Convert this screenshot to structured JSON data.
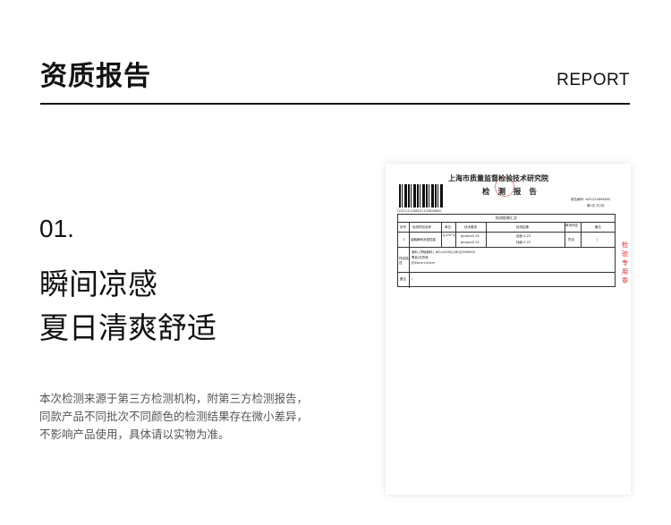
{
  "header": {
    "title": "资质报告",
    "title_en": "REPORT"
  },
  "section": {
    "number": "01.",
    "headline_line1": "瞬间凉感",
    "headline_line2": "夏日清爽舒适",
    "description": [
      "本次检测来源于第三方检测机构，附第三方检测报告，",
      "同款产品不同批次不同颜色的检测结果存在微小差异，",
      "不影响产品使用，具体请以实物为准。"
    ]
  },
  "document": {
    "institute": "上海市质量监督检验技术研究院",
    "subtitle": "检 测 报 告",
    "barcode_number": "(2021)11288201105898800",
    "report_no": "报告编号: W01220898800",
    "page_no": "第2页 共2页",
    "table_caption": "检测结果汇总",
    "headers": [
      "序号",
      "检测项目名称",
      "单位",
      "技术要求",
      "检测结果",
      "单项判定",
      "备注"
    ],
    "row": {
      "index": "1",
      "item": "接触瞬间凉感性能",
      "unit": "J/(cm²·s)",
      "req1": "qmax≥0.15",
      "req2": "qmax≥0.15",
      "res1": "经面 0.23",
      "res2": "纬面 0.23",
      "judge": "符合",
      "note": "/"
    },
    "sample_label": "样品描述",
    "sample_lines": [
      "面料 (拼接面料) 160-(0430)(160)(590630)",
      "黑色/无异味",
      "约40cm×40cm"
    ],
    "remark_label": "备注",
    "remark_value": "/",
    "side_text": "检验专用章"
  },
  "colors": {
    "text": "#111111",
    "body_text": "#555555",
    "stamp": "#dd2222"
  }
}
